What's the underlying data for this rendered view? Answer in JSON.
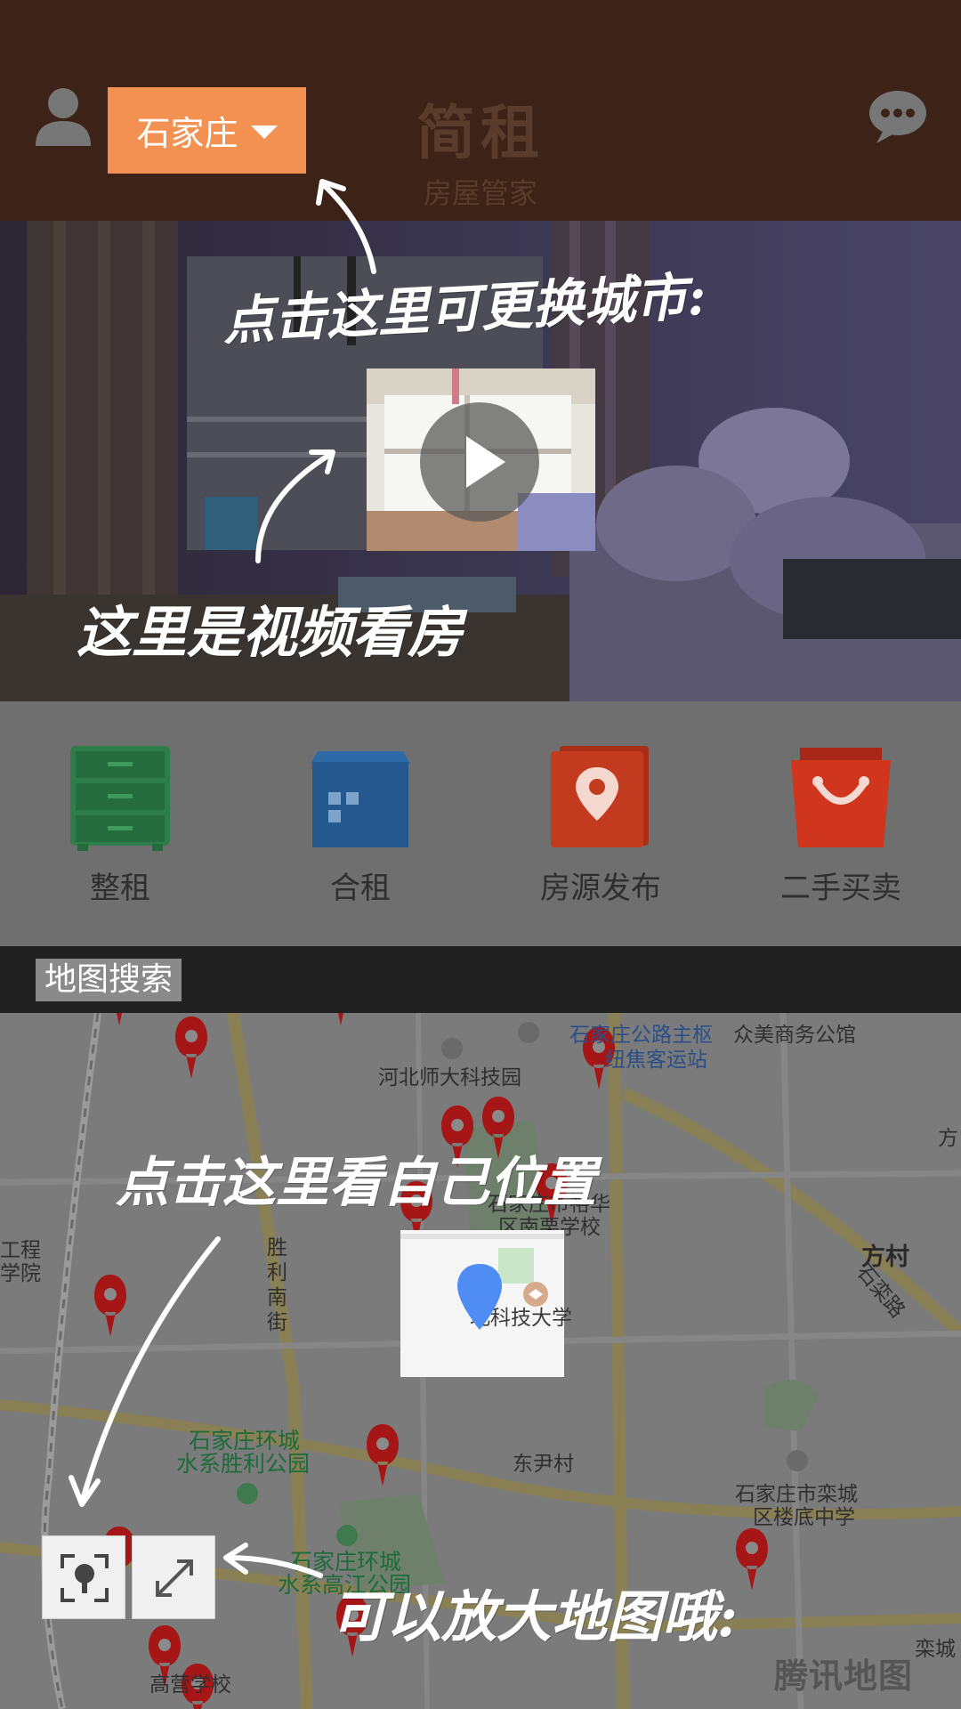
{
  "header": {
    "city": "石家庄",
    "title": "简租",
    "subtitle": "房屋管家"
  },
  "categories": [
    {
      "label": "整租",
      "icon": "drawer-cabinet-icon",
      "color": "#2e7d4a"
    },
    {
      "label": "合租",
      "icon": "building-icon",
      "color": "#24588f"
    },
    {
      "label": "房源发布",
      "icon": "map-pin-icon",
      "color": "#c23b1f"
    },
    {
      "label": "二手买卖",
      "icon": "shopping-bag-icon",
      "color": "#d0361e"
    }
  ],
  "map_section": {
    "title": "地图搜索",
    "watermark": "腾讯地图",
    "places": {
      "p1": "河北师大科技园",
      "p2": "石家庄公路主枢",
      "p3": "纽焦客运站",
      "p4": "众美商务公馆",
      "p5": "石家庄市裕华",
      "p6": "区南栗学校",
      "p7": "北科技大学",
      "p8": "方村",
      "p9": "石家庄环城",
      "p10": "水系胜利公园",
      "p11": "东尹村",
      "p12": "石家庄市栾城",
      "p13": "区楼底中学",
      "p14": "石家庄环城",
      "p15": "水系高江公园",
      "p16": "高营学校",
      "p17": "胜利南街",
      "p18": "石栾路",
      "p19": "工程",
      "p20": "学院",
      "p21": "方",
      "p22": "栾城"
    }
  },
  "guide_notes": {
    "city_note": "点击这里可更换城市:",
    "video_note": "这里是视频看房",
    "location_note": "点击这里看自己位置",
    "zoom_note": "可以放大地图哦:"
  },
  "colors": {
    "header_bg": "#3c2217",
    "city_button": "#f39152",
    "pin_red": "#c41a1a",
    "location_blue": "#4f8df5"
  }
}
